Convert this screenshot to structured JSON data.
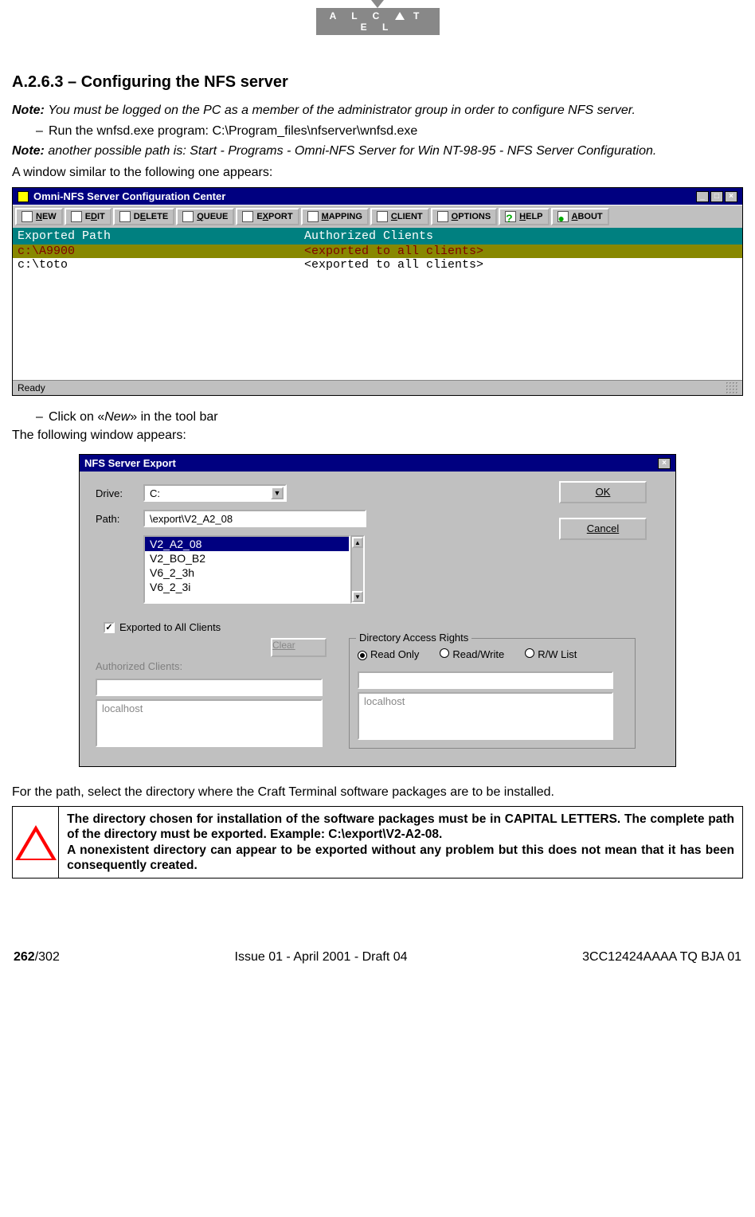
{
  "logo": {
    "text": "A L C   T E L"
  },
  "heading": "A.2.6.3 – Configuring the NFS server",
  "note1": {
    "label": "Note:",
    "text": "You must be logged on the PC as a member of the administrator group in order to configure NFS server."
  },
  "bullet1": "Run the wnfsd.exe program: C:\\Program_files\\nfserver\\wnfsd.exe",
  "note2": {
    "label": "Note:",
    "text": "another possible path is: Start - Programs - Omni-NFS Server for Win NT-98-95 - NFS Server Configuration."
  },
  "para1": "A window similar to the following one appears:",
  "win1": {
    "title": "Omni-NFS Server Configuration Center",
    "toolbar": [
      "NEW",
      "EDIT",
      "DELETE",
      "QUEUE",
      "EXPORT",
      "MAPPING",
      "CLIENT",
      "OPTIONS",
      "HELP",
      "ABOUT"
    ],
    "col1": "Exported Path",
    "col2": "Authorized Clients",
    "rows": [
      {
        "path": "c:\\A9900",
        "auth": "<exported to all clients>",
        "selected": true
      },
      {
        "path": "c:\\toto",
        "auth": "<exported to all clients>",
        "selected": false
      }
    ],
    "status": "Ready"
  },
  "bullet2a": "Click on «",
  "bullet2b": "New",
  "bullet2c": "» in the tool bar",
  "para2": "The following window appears:",
  "win2": {
    "title": "NFS Server Export",
    "drive_label": "Drive:",
    "drive_value": "C:",
    "path_label": "Path:",
    "path_value": "\\export\\V2_A2_08",
    "list": [
      "V2_A2_08",
      "V2_BO_B2",
      "V6_2_3h",
      "V6_2_3i"
    ],
    "ok": "OK",
    "cancel": "Cancel",
    "chk_label": "Exported to All Clients",
    "chk_checked": "✓",
    "clear": "Clear",
    "auth_label": "Authorized   Clients:",
    "localhost": "localhost",
    "rights_legend": "Directory Access Rights",
    "r1": "Read Only",
    "r2": "Read/Write",
    "r3": "R/W List"
  },
  "para3": "For the path, select the directory where the Craft Terminal software packages are to be installed.",
  "warn1": "The directory chosen for installation of the software packages must be in CAPITAL LETTERS. The complete path of the directory must be exported. Example: C:\\export\\V2-A2-08.",
  "warn2": "A nonexistent directory can appear to be exported without any problem but this does not mean that it has been consequently created.",
  "footer": {
    "page_bold": "262",
    "page_rest": "/302",
    "center": "Issue 01 - April 2001 - Draft 04",
    "right": "3CC12424AAAA TQ BJA 01"
  }
}
